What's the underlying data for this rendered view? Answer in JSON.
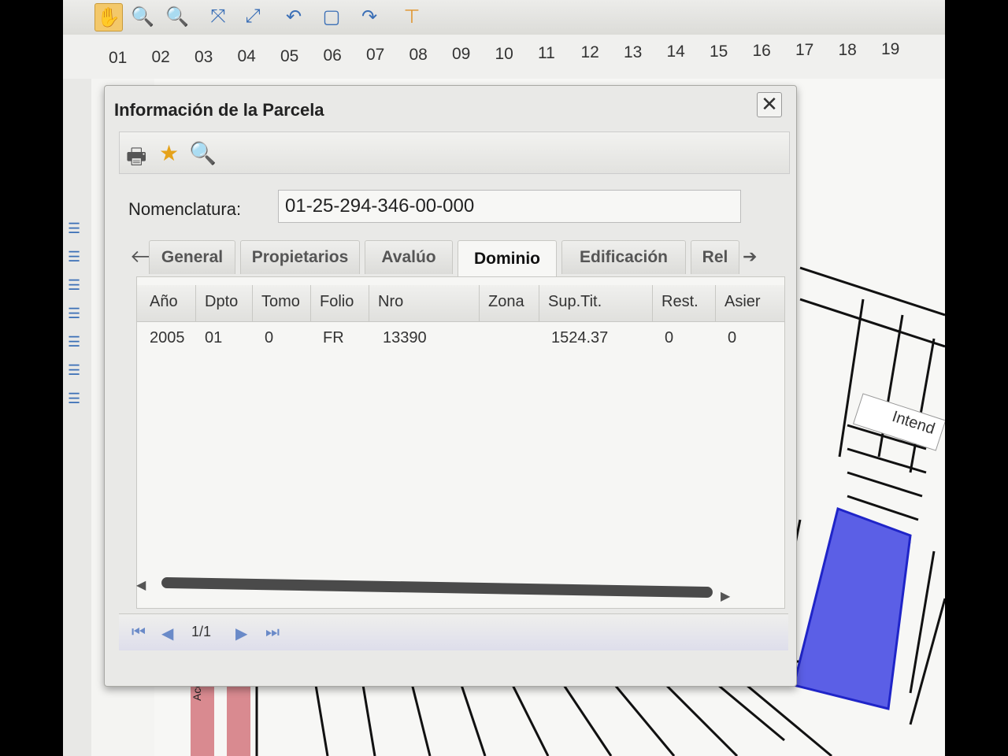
{
  "toolbar": {
    "tools": [
      {
        "name": "hand-tool",
        "icon": "✋",
        "active": true
      },
      {
        "name": "zoom-in",
        "icon": "🔍"
      },
      {
        "name": "zoom-out",
        "icon": "🔍"
      },
      {
        "name": "zoom-extent",
        "icon": "⤧"
      },
      {
        "name": "zoom-full",
        "icon": "⤢"
      },
      {
        "name": "undo",
        "icon": "↶"
      },
      {
        "name": "zoom-box",
        "icon": "▢"
      },
      {
        "name": "redo",
        "icon": "↷"
      },
      {
        "name": "measure",
        "icon": "⊤"
      }
    ]
  },
  "ruler": [
    "01",
    "02",
    "03",
    "04",
    "05",
    "06",
    "07",
    "08",
    "09",
    "10",
    "11",
    "12",
    "13",
    "14",
    "15",
    "16",
    "17",
    "18",
    "19"
  ],
  "dialog": {
    "title": "Información de la Parcela",
    "close_label": "✕",
    "nomenclatura_label": "Nomenclatura:",
    "nomenclatura_value": "01-25-294-346-00-000",
    "tabs": [
      "General",
      "Propietarios",
      "Avalúo",
      "Dominio",
      "Edificación",
      "Rel"
    ],
    "active_tab": "Dominio",
    "tab_prev": "🡐",
    "tab_next": "➔",
    "columns": [
      "Año",
      "Dpto",
      "Tomo",
      "Folio",
      "Nro",
      "Zona",
      "Sup.Tit.",
      "Rest.",
      "Asier"
    ],
    "rows": [
      [
        "2005",
        "01",
        "0",
        "FR",
        "13390",
        "",
        "1524.37",
        "0",
        "0"
      ]
    ],
    "pager": {
      "page": "1/1"
    }
  },
  "map": {
    "street_label": "Intend",
    "side_label": "Acceso N",
    "highlight_color": "#5b5fe6"
  }
}
